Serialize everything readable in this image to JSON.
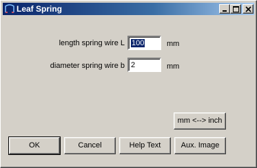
{
  "window": {
    "title": "Leaf Spring",
    "icon": "leaf-spring-app-icon",
    "controls": {
      "minimize": "_",
      "maximize": "□",
      "close": "×"
    }
  },
  "form": {
    "length": {
      "label": "length spring wire L",
      "value": "100",
      "unit": "mm"
    },
    "diameter": {
      "label": "diameter spring wire b",
      "value": "2",
      "unit": "mm"
    }
  },
  "buttons": {
    "convert": "mm <--> inch",
    "ok": "OK",
    "cancel": "Cancel",
    "help": "Help Text",
    "aux": "Aux. Image"
  },
  "colors": {
    "titlebar_start": "#0a246a",
    "titlebar_end": "#a6caf0",
    "face": "#d4d0c8"
  }
}
